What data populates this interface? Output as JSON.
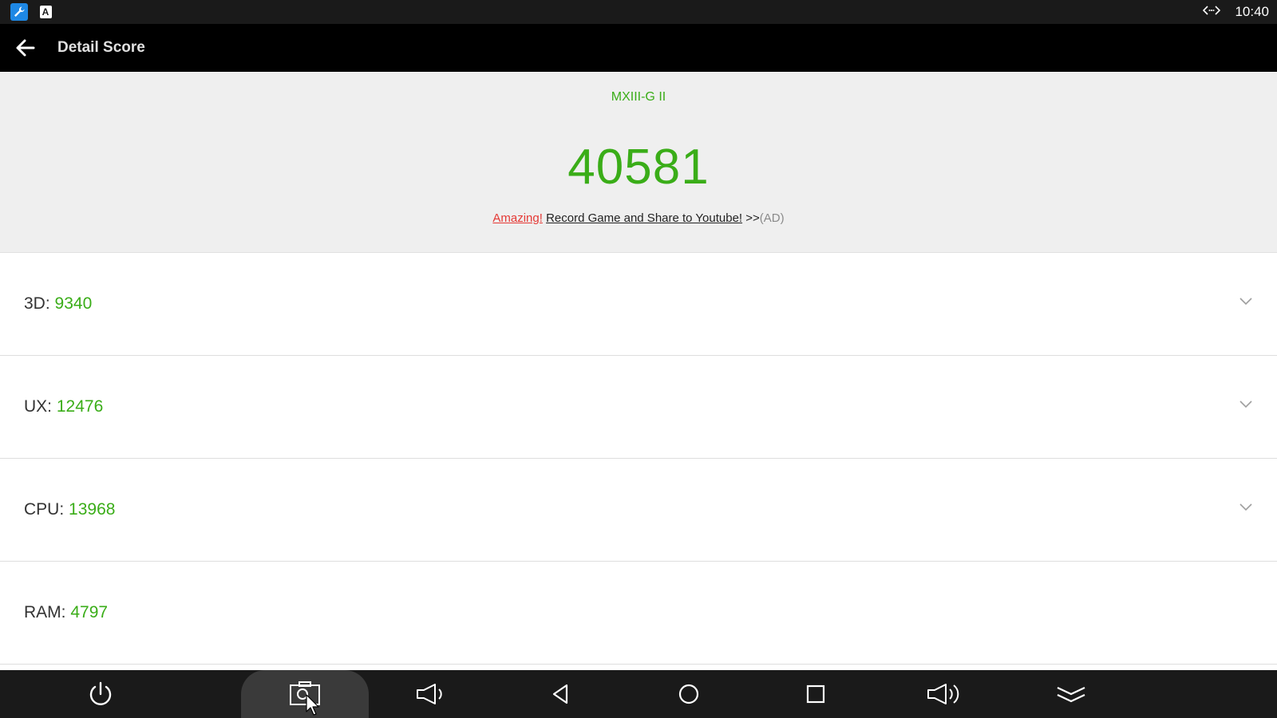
{
  "status_bar": {
    "time": "10:40",
    "app_icons": [
      "wrench-app-icon",
      "a-app-icon"
    ],
    "a_app_letter": "A"
  },
  "app_bar": {
    "title": "Detail Score"
  },
  "header": {
    "device_name": "MXIII-G II",
    "total_score": "40581",
    "ad": {
      "highlight": "Amazing!",
      "link": "Record Game and Share to Youtube!",
      "arrows": ">>",
      "tag": "(AD)"
    }
  },
  "scores": [
    {
      "label": "3D:",
      "value": "9340",
      "expandable": true
    },
    {
      "label": "UX:",
      "value": "12476",
      "expandable": true
    },
    {
      "label": "CPU:",
      "value": "13968",
      "expandable": true
    },
    {
      "label": "RAM:",
      "value": "4797",
      "expandable": false
    }
  ],
  "nav_bar": {
    "buttons": [
      "power-icon",
      "screenshot-icon",
      "volume-down-icon",
      "back-triangle-icon",
      "home-circle-icon",
      "recents-square-icon",
      "volume-up-icon",
      "collapse-chevrons-icon"
    ],
    "active": "screenshot-icon"
  },
  "colors": {
    "accent_green": "#3aad18",
    "ad_red": "#e53935",
    "bar_black": "#000000",
    "status_bg": "#1a1a1a",
    "header_bg": "#efefef"
  }
}
